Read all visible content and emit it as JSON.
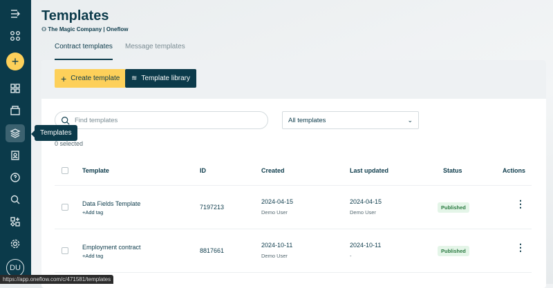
{
  "sidebar": {
    "avatar": "DU",
    "tooltip": "Templates"
  },
  "header": {
    "title": "Templates",
    "subtitle": "The Magic Company | Oneflow"
  },
  "tabs": [
    {
      "label": "Contract templates"
    },
    {
      "label": "Message templates"
    }
  ],
  "toolbar": {
    "create": "Create template",
    "library": "Template library"
  },
  "filters": {
    "search_placeholder": "Find templates",
    "select_value": "All templates",
    "selected_count": "0 selected"
  },
  "table": {
    "headers": [
      "Template",
      "ID",
      "Created",
      "Last updated",
      "Status",
      "Actions"
    ],
    "rows": [
      {
        "name": "Data Fields Template",
        "tag": "+Add tag",
        "id": "7197213",
        "created": "2024-04-15",
        "created_by": "Demo User",
        "updated": "2024-04-15",
        "updated_by": "Demo User",
        "status": "Published"
      },
      {
        "name": "Employment contract",
        "tag": "+Add tag",
        "id": "8817661",
        "created": "2024-10-11",
        "created_by": "Demo User",
        "updated": "2024-10-11",
        "updated_by": "-",
        "status": "Published"
      }
    ]
  },
  "statusbar": {
    "url": "https://app.oneflow.com/c/471581/templates"
  }
}
